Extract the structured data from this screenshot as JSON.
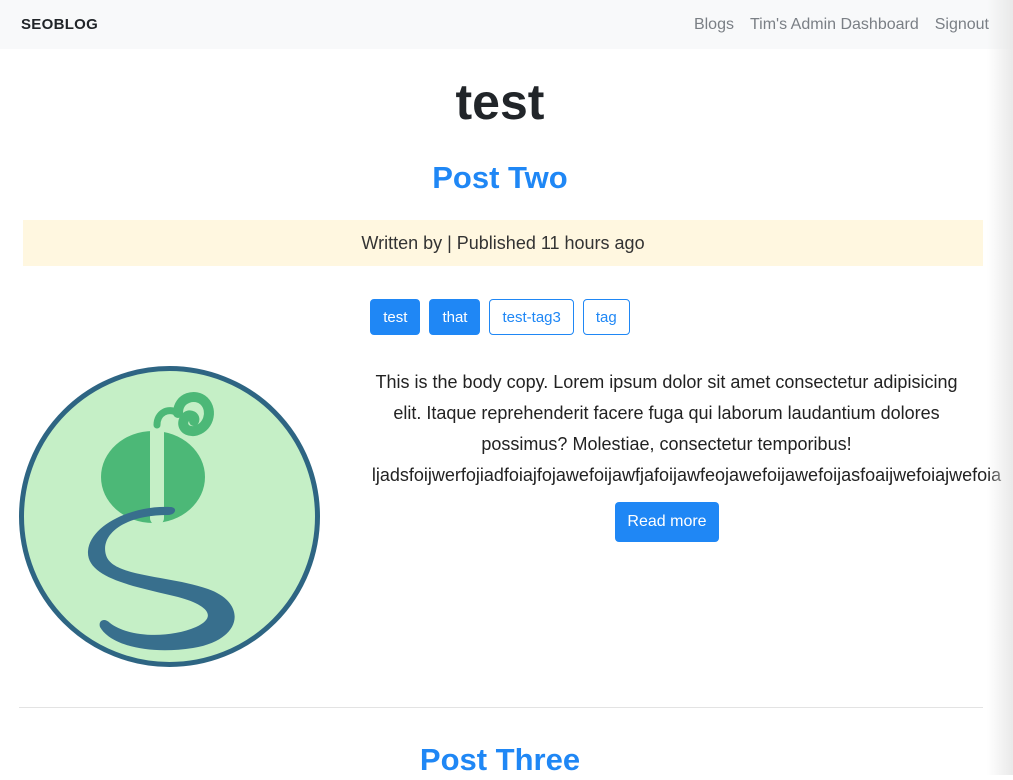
{
  "nav": {
    "brand": "SEOBLOG",
    "links": [
      "Blogs",
      "Tim's Admin Dashboard",
      "Signout"
    ]
  },
  "page": {
    "title": "test"
  },
  "posts": [
    {
      "title": "Post Two",
      "meta": "Written by | Published 11 hours ago",
      "tags": [
        {
          "label": "test",
          "style": "solid"
        },
        {
          "label": "that",
          "style": "solid"
        },
        {
          "label": "test-tag3",
          "style": "outline"
        },
        {
          "label": "tag",
          "style": "outline"
        }
      ],
      "excerpt_lines": [
        "This is the body copy. Lorem ipsum dolor sit amet consectetur adipisicing",
        "elit. Itaque reprehenderit facere fuga qui laborum laudantium dolores",
        "possimus? Molestiae, consectetur temporibus!",
        "ljadsfoijwerfojiadfoiajfojawefoijawfjafoijawfeojawefoijawefoijasfoaijwefoiajwefoia"
      ],
      "read_more": "Read more",
      "image_icon": "g-logo-icon"
    },
    {
      "title": "Post Three"
    }
  ],
  "colors": {
    "accent": "#1f87f5",
    "meta_bg": "#fff7e0",
    "navbar_bg": "#f8f9fa",
    "logo_circle": "#c5efc6",
    "logo_ring": "#2e6583",
    "logo_green": "#4cb877",
    "logo_blue": "#386f8d"
  }
}
